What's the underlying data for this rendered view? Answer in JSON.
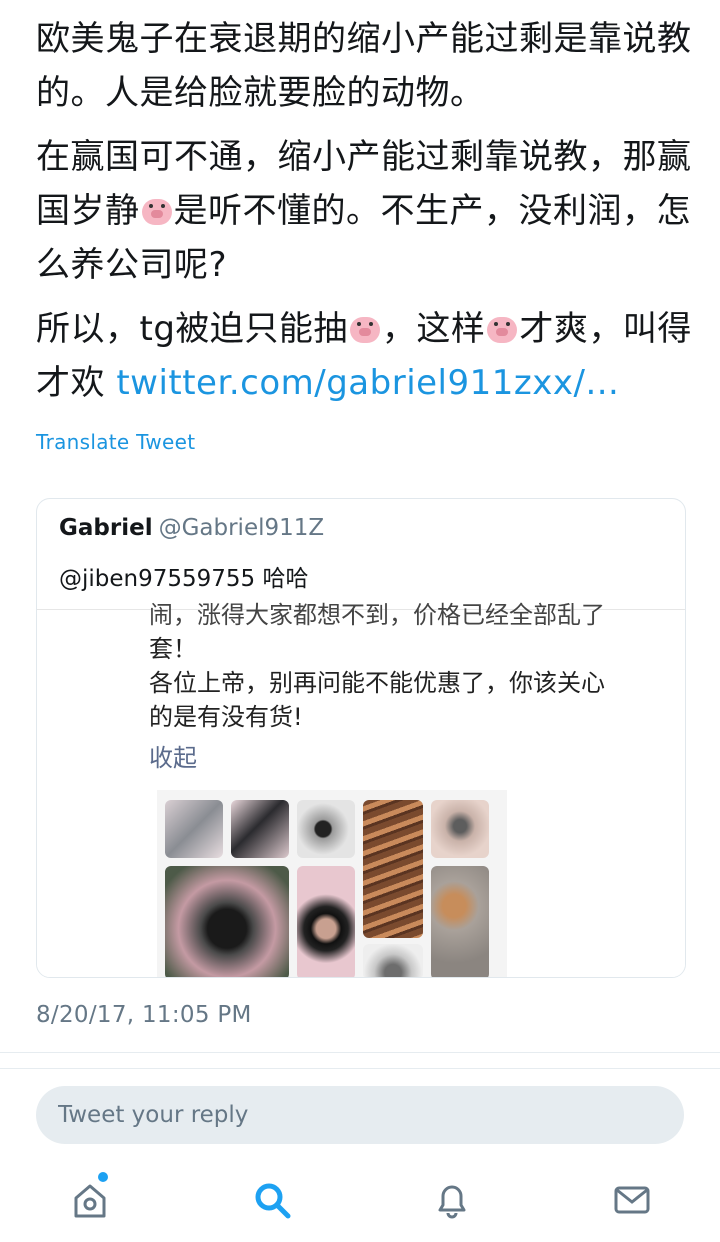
{
  "tweet": {
    "paragraphs": [
      {
        "before": "欧美鬼子在衰退期的缩小产能过剩是靠说教的。人是给脸就要脸的动物。"
      },
      {
        "before": "在赢国可不通，缩小产能过剩靠说教，那赢国岁静",
        "after": "是听不懂的。不生产，没利润，怎么养公司呢?"
      },
      {
        "before": "所以，tg被迫只能抽",
        "middle": "，这样",
        "after": "才爽，叫得才欢 ",
        "link": "twitter.com/gabriel911zxx/..."
      }
    ],
    "emoji": "pig-face-icon",
    "translate_label": "Translate Tweet",
    "timestamp": "8/20/17, 11:05 PM"
  },
  "quote": {
    "name": "Gabriel",
    "handle": "@Gabriel911Z",
    "text": "@jiben97559755 哈哈",
    "embedded_post": {
      "cut_line": "闹，涨得大家都想不到，价格已经全部乱了",
      "lines": "套！\n各位上帝，别再问能不能优惠了，你该关心\n的是有没有货!",
      "collapse_label": "收起"
    }
  },
  "reply": {
    "placeholder": "Tweet your reply"
  },
  "tabs": [
    {
      "name": "home",
      "icon": "home-icon",
      "has_notification_dot": true
    },
    {
      "name": "search",
      "icon": "search-icon",
      "active": true
    },
    {
      "name": "notifications",
      "icon": "bell-icon"
    },
    {
      "name": "messages",
      "icon": "mail-icon"
    }
  ],
  "colors": {
    "link": "#1b95e0",
    "accent": "#1da1f2",
    "muted": "#657786",
    "reply_bg": "#e6ecf0"
  }
}
